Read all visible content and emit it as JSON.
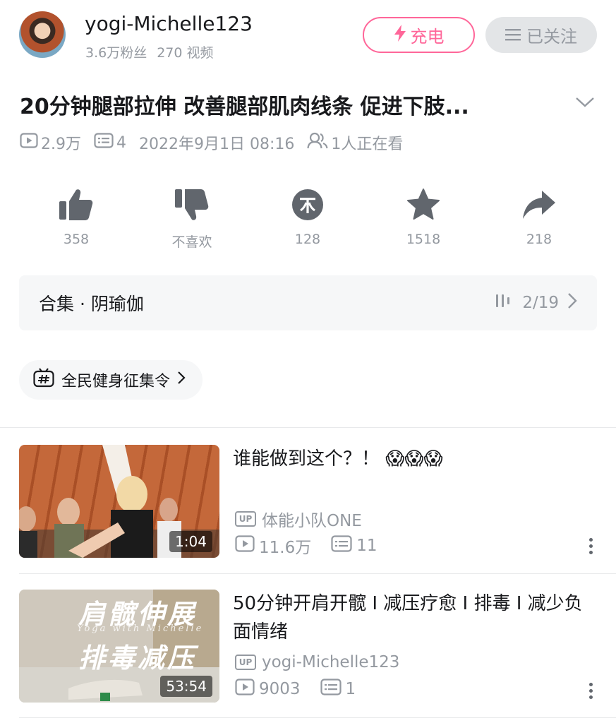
{
  "uploader": {
    "name": "yogi-Michelle123",
    "followers": "3.6万粉丝",
    "videos": "270 视频",
    "charge_label": "充电",
    "follow_label": "已关注"
  },
  "video": {
    "title": "20分钟腿部拉伸 改善腿部肌肉线条 促进下肢...",
    "views": "2.9万",
    "danmaku": "4",
    "date": "2022年9月1日 08:16",
    "watching": "1人正在看"
  },
  "actions": {
    "like": "358",
    "dislike": "不喜欢",
    "coin": "128",
    "favorite": "1518",
    "share": "218"
  },
  "collection": {
    "title": "合集 · 阴瑜伽",
    "progress": "2/19"
  },
  "tag": {
    "label": "全民健身征集令"
  },
  "related": [
    {
      "title": "谁能做到这个？！ 😱😱😱",
      "uploader": "体能小队ONE",
      "views": "11.6万",
      "danmaku": "11",
      "duration": "1:04"
    },
    {
      "title": "50分钟开肩开髋 I 减压疗愈 I 排毒 I 减少负面情绪",
      "uploader": "yogi-Michelle123",
      "views": "9003",
      "danmaku": "1",
      "duration": "53:54",
      "thumb_line1": "肩髋伸展",
      "thumb_line2": "排毒减压",
      "thumb_sub": "Yoga with Michelle"
    }
  ],
  "icons": {
    "play": "play-icon",
    "danmaku": "danmaku-icon",
    "viewers": "viewers-icon",
    "like": "thumbs-up-icon",
    "dislike": "thumbs-down-icon",
    "coin": "coin-icon",
    "favorite": "star-icon",
    "share": "share-icon"
  },
  "colors": {
    "accent": "#ff6699",
    "muted": "#9499a0",
    "action_icon": "#61666d",
    "panel_bg": "#f6f7f8"
  }
}
